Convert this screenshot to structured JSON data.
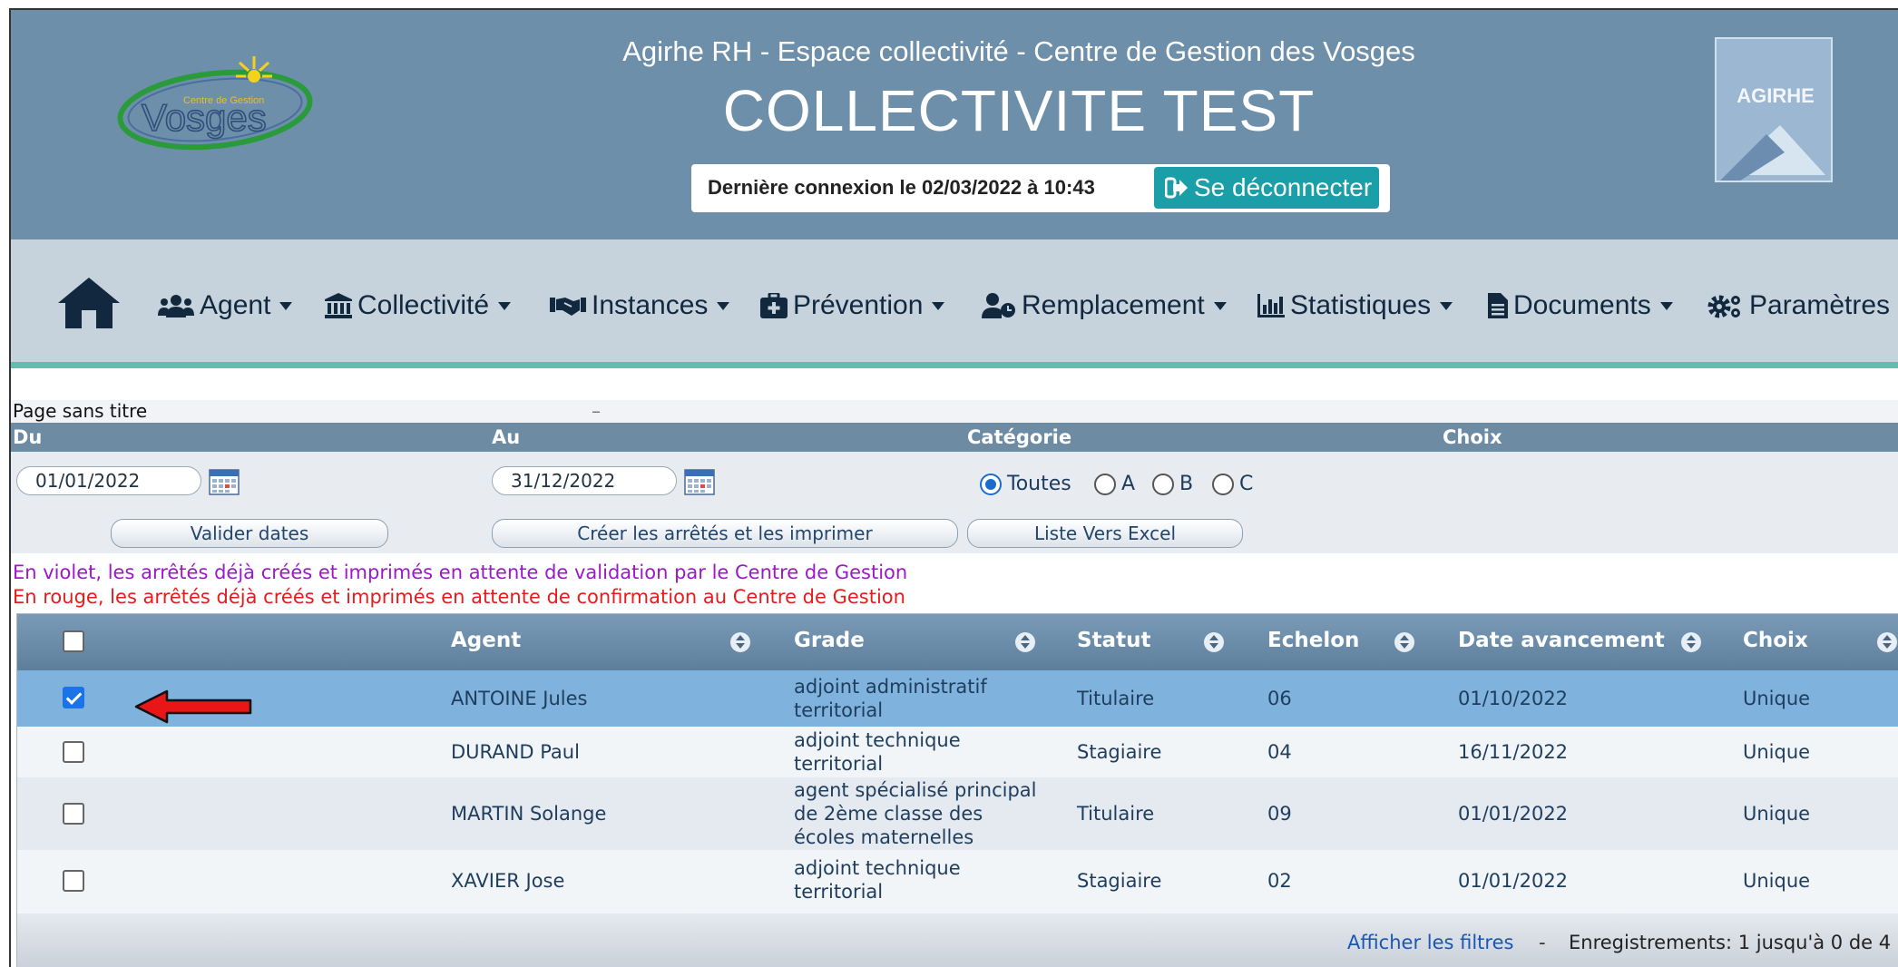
{
  "header": {
    "subtitle": "Agirhe RH - Espace collectivité - Centre de Gestion des Vosges",
    "title": "COLLECTIVITE TEST",
    "last_login": "Dernière connexion le 02/03/2022 à 10:43",
    "logout_label": "Se déconnecter",
    "logo_left_text": "Vosges",
    "logo_left_small": "Centre de Gestion",
    "logo_right_text": "AGIRHE"
  },
  "nav": {
    "items": [
      {
        "label": "Agent",
        "icon": "users-icon"
      },
      {
        "label": "Collectivité",
        "icon": "institution-icon"
      },
      {
        "label": "Instances",
        "icon": "handshake-icon"
      },
      {
        "label": "Prévention",
        "icon": "medkit-icon"
      },
      {
        "label": "Remplacement",
        "icon": "user-clock-icon"
      },
      {
        "label": "Statistiques",
        "icon": "bar-chart-icon"
      },
      {
        "label": "Documents",
        "icon": "file-icon"
      },
      {
        "label": "Paramètres",
        "icon": "gears-icon"
      }
    ]
  },
  "page": {
    "title": "Page sans titre",
    "dash": "–"
  },
  "filters": {
    "du_label": "Du",
    "au_label": "Au",
    "categorie_label": "Catégorie",
    "choix_label": "Choix",
    "date_from": "01/01/2022",
    "date_to": "31/12/2022",
    "radios": [
      "Toutes",
      "A",
      "B",
      "C"
    ],
    "selected": "Toutes",
    "btn_validate": "Valider dates",
    "btn_create": "Créer les arrêtés et les imprimer",
    "btn_excel": "Liste Vers Excel"
  },
  "legend": {
    "violet": "En violet, les arrêtés déjà créés et imprimés en attente de validation par le Centre de Gestion",
    "rouge": "En rouge, les arrêtés déjà créés et imprimés en attente de confirmation au Centre de Gestion",
    "violet_color": "#9b19c8",
    "rouge_color": "#e81b1b"
  },
  "table": {
    "columns": [
      "Agent",
      "Grade",
      "Statut",
      "Echelon",
      "Date avancement",
      "Choix"
    ],
    "rows": [
      {
        "checked": true,
        "agent": "ANTOINE Jules",
        "grade": [
          "adjoint administratif",
          "territorial"
        ],
        "statut": "Titulaire",
        "echelon": "06",
        "date": "01/10/2022",
        "choix": "Unique"
      },
      {
        "checked": false,
        "agent": "DURAND Paul",
        "grade": [
          "adjoint technique",
          "territorial"
        ],
        "statut": "Stagiaire",
        "echelon": "04",
        "date": "16/11/2022",
        "choix": "Unique"
      },
      {
        "checked": false,
        "agent": "MARTIN Solange",
        "grade": [
          "agent spécialisé principal",
          "de 2ème classe des",
          "écoles maternelles"
        ],
        "statut": "Titulaire",
        "echelon": "09",
        "date": "01/01/2022",
        "choix": "Unique"
      },
      {
        "checked": false,
        "agent": "XAVIER Jose",
        "grade": [
          "adjoint technique",
          "territorial"
        ],
        "statut": "Stagiaire",
        "echelon": "02",
        "date": "01/01/2022",
        "choix": "Unique"
      }
    ],
    "footer_link": "Afficher les filtres",
    "footer_sep": "-",
    "footer_count": "Enregistrements: 1 jusqu'à 0 de 4"
  },
  "colors": {
    "header_bg": "#6d8fa9",
    "nav_bg": "#c6d3dd",
    "accent": "#5fbfae",
    "selected_row": "#7fb2dc",
    "logout_bg": "#1a9ea8"
  }
}
